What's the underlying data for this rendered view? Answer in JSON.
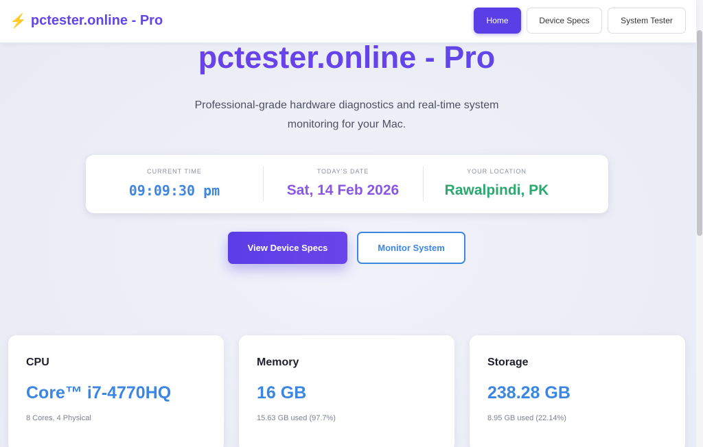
{
  "navbar": {
    "brand": "pctester.online - Pro",
    "links": [
      "Home",
      "Device Specs",
      "System Tester"
    ]
  },
  "hero": {
    "title": "pctester.online - Pro",
    "subtitle": "Professional-grade hardware diagnostics and real-time system monitoring for your Mac."
  },
  "info": {
    "time_label": "CURRENT TIME",
    "time_value": "09:09:30 pm",
    "date_label": "TODAY'S DATE",
    "date_value": "Sat, 14 Feb 2026",
    "location_label": "YOUR LOCATION",
    "location_value": "Rawalpindi, PK"
  },
  "actions": {
    "primary": "View Device Specs",
    "secondary": "Monitor System"
  },
  "cards": [
    {
      "title": "CPU",
      "value": "Core™ i7-4770HQ",
      "sub": "8 Cores, 4 Physical"
    },
    {
      "title": "Memory",
      "value": "16 GB",
      "sub": "15.63 GB used (97.7%)"
    },
    {
      "title": "Storage",
      "value": "238.28 GB",
      "sub": "8.95 GB used (22.14%)"
    }
  ],
  "colors": {
    "accent": "#5a3ee6",
    "blue": "#3f86e0",
    "purple": "#8a56e6",
    "green": "#2ca86f"
  }
}
